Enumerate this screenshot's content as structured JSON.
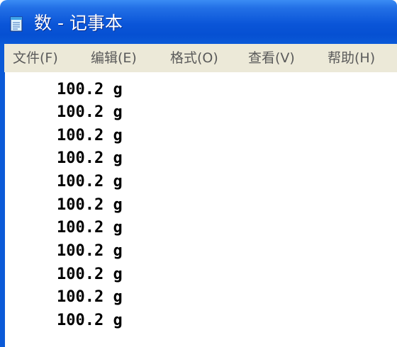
{
  "window": {
    "title": "数 - 记事本"
  },
  "menu": [
    {
      "label": "文件(F)"
    },
    {
      "label": "编辑(E)"
    },
    {
      "label": "格式(O)"
    },
    {
      "label": "查看(V)"
    },
    {
      "label": "帮助(H)"
    }
  ],
  "editor": {
    "lines": [
      "100.2 g",
      "100.2 g",
      "100.2 g",
      "100.2 g",
      "100.2 g",
      "100.2 g",
      "100.2 g",
      "100.2 g",
      "100.2 g",
      "100.2 g",
      "100.2 g"
    ]
  },
  "colors": {
    "titlebar": "#0a55d8",
    "menubar": "#ece9d8",
    "text": "#000000"
  },
  "icons": {
    "app": "notepad-icon"
  }
}
